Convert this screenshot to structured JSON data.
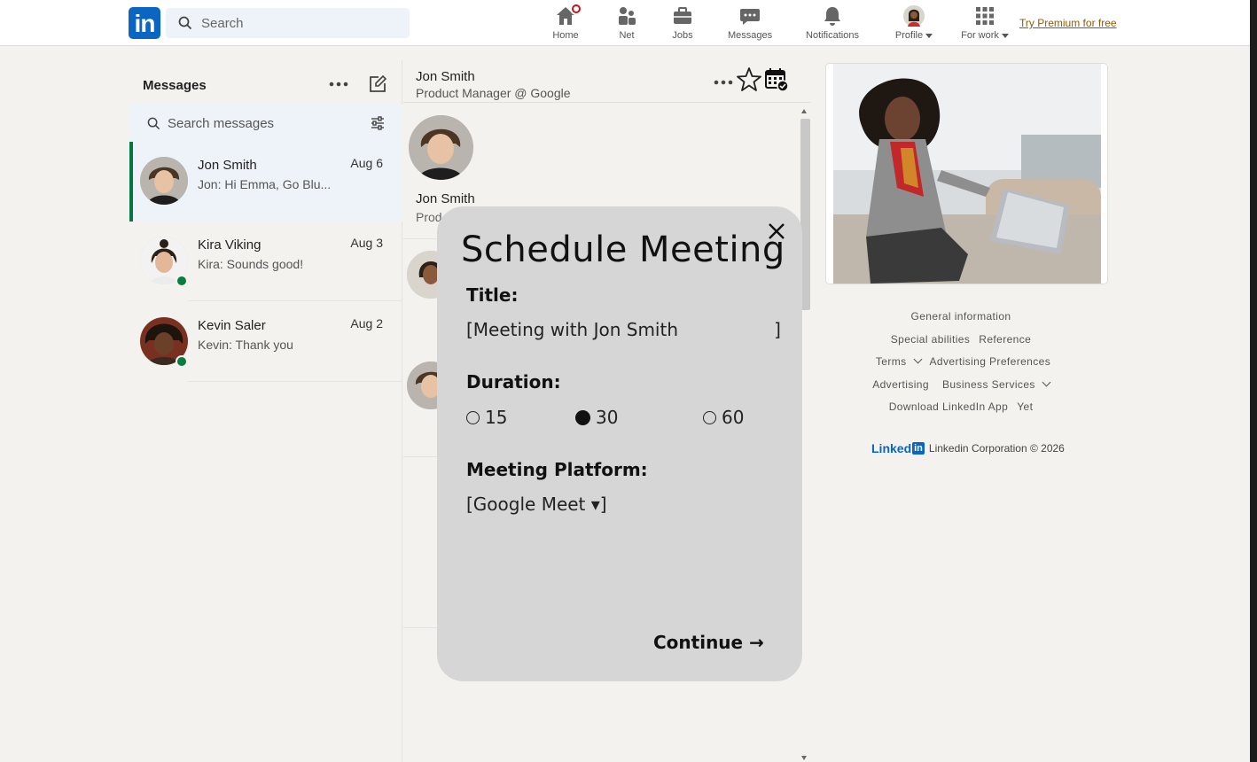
{
  "nav": {
    "logo_text": "in",
    "search_placeholder": "Search",
    "items": [
      {
        "label": "Home",
        "icon": "home-icon"
      },
      {
        "label": "Net",
        "icon": "people-icon"
      },
      {
        "label": "Jobs",
        "icon": "briefcase-icon"
      },
      {
        "label": "Messages",
        "icon": "chat-icon"
      },
      {
        "label": "Notifications",
        "icon": "bell-icon"
      },
      {
        "label": "Profile",
        "icon": "avatar"
      },
      {
        "label": "For work",
        "icon": "grid-icon"
      }
    ],
    "premium": "Try Premium for free"
  },
  "messages": {
    "title": "Messages",
    "search_placeholder": "Search messages",
    "conversations": [
      {
        "name": "Jon Smith",
        "date": "Aug 6",
        "preview": "Jon:  Hi Emma, Go Blu...",
        "online": false,
        "active": true
      },
      {
        "name": "Kira Viking",
        "date": "Aug 3",
        "preview": "Kira:  Sounds good!",
        "online": true,
        "active": false
      },
      {
        "name": "Kevin Saler",
        "date": "Aug 2",
        "preview": "Kevin:  Thank you",
        "online": true,
        "active": false
      }
    ]
  },
  "chat": {
    "name": "Jon Smith",
    "subtitle": "Product Manager @ Google",
    "profile_name": "Jon Smith",
    "profile_sub": "Prod"
  },
  "modal": {
    "title": "Schedule Meeting",
    "title_label": "Title:",
    "title_value": "[Meeting with Jon Smith                 ]",
    "duration_label": "Duration:",
    "durations": [
      {
        "value": "15",
        "selected": false
      },
      {
        "value": "30",
        "selected": true
      },
      {
        "value": "60",
        "selected": false
      }
    ],
    "platform_label": "Meeting Platform:",
    "platform_value": "[Google Meet ▾]",
    "continue_label": "Continue →"
  },
  "footer": {
    "links": [
      "General information",
      "Special abilities",
      "Reference",
      "Terms",
      "Advertising Preferences",
      "Advertising",
      "Business Services",
      "Download LinkedIn App",
      "Yet"
    ],
    "brand": "Linked",
    "brand_in": "in",
    "copyright": "Linkedin Corporation © 2026"
  },
  "colors": {
    "brand": "#0a66c2",
    "online": "#0a7c3d",
    "active_bar": "#057642",
    "modal_bg": "#d6d6d6",
    "premium": "#915907"
  }
}
